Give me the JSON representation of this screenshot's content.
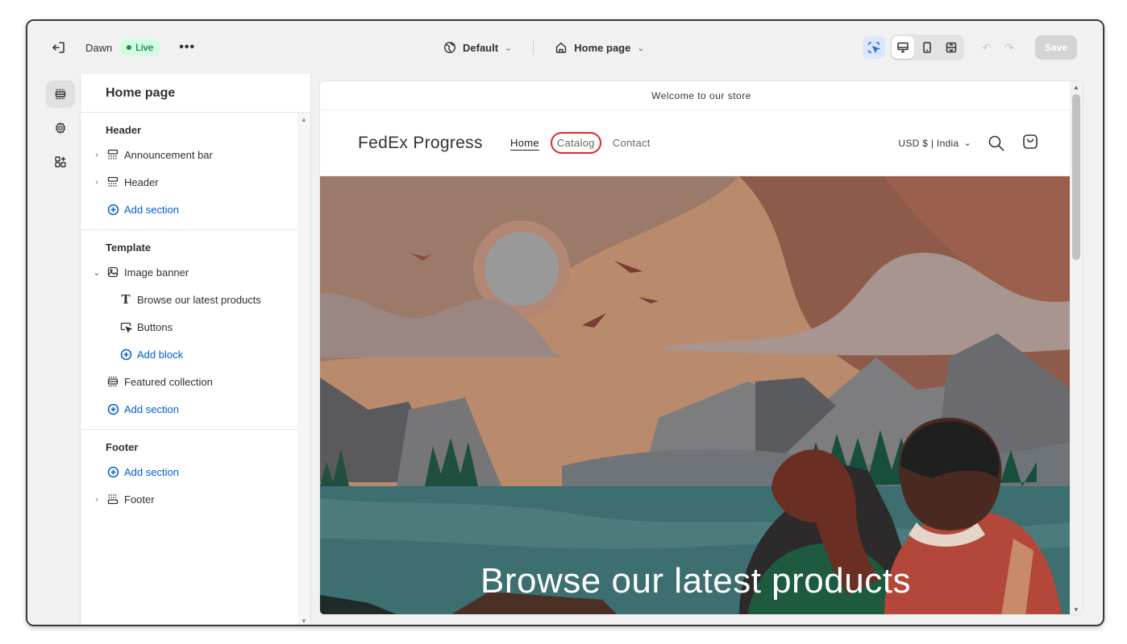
{
  "topbar": {
    "theme_name": "Dawn",
    "live_label": "Live",
    "template_label": "Default",
    "page_label": "Home page",
    "save_label": "Save"
  },
  "sidebar": {
    "title": "Home page",
    "header_group": {
      "label": "Header",
      "items": [
        "Announcement bar",
        "Header"
      ],
      "add_label": "Add section"
    },
    "template_group": {
      "label": "Template",
      "section": "Image banner",
      "blocks": [
        "Browse our latest products",
        "Buttons"
      ],
      "add_block_label": "Add block",
      "section2": "Featured collection",
      "add_label": "Add section"
    },
    "footer_group": {
      "label": "Footer",
      "add_label": "Add section",
      "items": [
        "Footer"
      ]
    }
  },
  "preview": {
    "announcement": "Welcome to our store",
    "logo": "FedEx Progress",
    "nav": [
      "Home",
      "Catalog",
      "Contact"
    ],
    "locale": "USD $ | India",
    "hero_heading": "Browse our latest products"
  },
  "colors": {
    "accent_blue": "#005bd3",
    "live_green": "#29845a",
    "highlight_red": "#e0242a"
  }
}
